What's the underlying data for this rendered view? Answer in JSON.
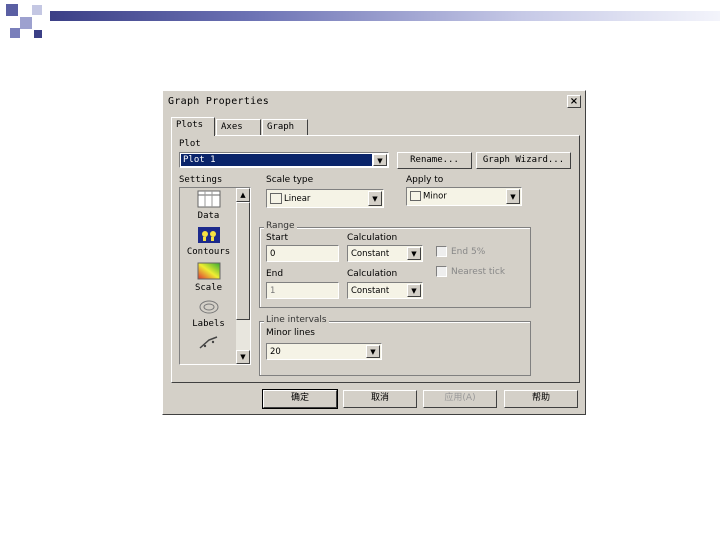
{
  "dialog": {
    "title": "Graph Properties",
    "close_glyph": "×",
    "tabs": [
      {
        "label": "Plots"
      },
      {
        "label": "Axes"
      },
      {
        "label": "Graph"
      }
    ]
  },
  "plot": {
    "label": "Plot",
    "selected": "Plot 1",
    "rename_label": "Rename...",
    "wizard_label": "Graph Wizard..."
  },
  "settings": {
    "label": "Settings",
    "items": [
      {
        "label": "Data",
        "icon": "data-icon"
      },
      {
        "label": "Contours",
        "icon": "contours-icon"
      },
      {
        "label": "Scale",
        "icon": "scale-icon"
      },
      {
        "label": "Labels",
        "icon": "labels-icon"
      }
    ]
  },
  "scale_type": {
    "label": "Scale type",
    "value": "Linear"
  },
  "apply_to": {
    "label": "Apply to",
    "value": "Minor"
  },
  "range": {
    "label": "Range",
    "start_label": "Start",
    "start_value": "0",
    "start_calc_label": "Calculation",
    "start_calc_value": "Constant",
    "end_label": "End",
    "end_value": "1",
    "end_calc_label": "Calculation",
    "end_calc_value": "Constant",
    "end5_label": "End 5%",
    "nearest_tick_label": "Nearest tick"
  },
  "line_intervals": {
    "label": "Line intervals",
    "minor_lines_label": "Minor lines",
    "minor_lines_value": "20"
  },
  "footer": {
    "ok": "确定",
    "cancel": "取消",
    "apply": "应用(A)",
    "help": "帮助"
  },
  "colors": {
    "dialog_bg": "#d4d0c8",
    "selection": "#0a246a",
    "field_bg": "#f5f3e6",
    "slide_bar": "#3b3f86"
  }
}
